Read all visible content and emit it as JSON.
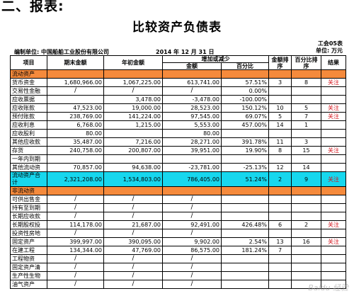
{
  "heading": "二、报表:",
  "title": "比较资产负债表",
  "form_code": "工会05表",
  "unit": "单位: 万元",
  "compiler": "编制单位: 中国船舶工业股份有限公司",
  "date": "2014 年 12 月 31 日",
  "headers": {
    "item": "项目",
    "end": "期末金额",
    "begin": "年初金额",
    "change": "增加或减少",
    "amount": "金额",
    "pct": "百分比",
    "rank_amount": "金额排序",
    "rank_pct": "百分比排序",
    "result": "结果"
  },
  "rows": [
    {
      "type": "section",
      "item": "流动资产"
    },
    {
      "item": "货币资金",
      "end": "1,680,966.00",
      "begin": "1,067,225.00",
      "amount": "613,741.00",
      "pct": "57.51%",
      "ra": "3",
      "rp": "8",
      "res": "关注"
    },
    {
      "item": "交易性金融",
      "end": "/",
      "begin": "/",
      "amount": "/",
      "pct": "0.00%",
      "ra": "",
      "rp": "",
      "res": ""
    },
    {
      "item": "应收票据",
      "end": "",
      "begin": "3,478.00",
      "amount": "-3,478.00",
      "pct": "-100.00%",
      "ra": "",
      "rp": "",
      "res": ""
    },
    {
      "item": "应收账款",
      "end": "47,523.00",
      "begin": "19,000.00",
      "amount": "28,523.00",
      "pct": "150.12%",
      "ra": "10",
      "rp": "5",
      "res": "关注"
    },
    {
      "item": "预付账款",
      "end": "238,769.00",
      "begin": "141,224.00",
      "amount": "97,545.00",
      "pct": "69.07%",
      "ra": "5",
      "rp": "7",
      "res": "关注"
    },
    {
      "item": "应收利息",
      "end": "6,768.00",
      "begin": "1,215.00",
      "amount": "5,553.00",
      "pct": "457.00%",
      "ra": "14",
      "rp": "1",
      "res": ""
    },
    {
      "item": "应收股利",
      "end": "80.00",
      "begin": "",
      "amount": "80.00",
      "pct": "",
      "ra": "",
      "rp": "",
      "res": ""
    },
    {
      "item": "其他应收款",
      "end": "35,487.00",
      "begin": "7,216.00",
      "amount": "28,271.00",
      "pct": "391.78%",
      "ra": "11",
      "rp": "3",
      "res": ""
    },
    {
      "item": "存货",
      "end": "240,758.00",
      "begin": "200,807.00",
      "amount": "39,951.00",
      "pct": "19.90%",
      "ra": "8",
      "rp": "15",
      "res": "关注"
    },
    {
      "item": "一年内到期",
      "end": "",
      "begin": "",
      "amount": "",
      "pct": "",
      "ra": "",
      "rp": "",
      "res": ""
    },
    {
      "item": "其他流动资",
      "end": "70,857.00",
      "begin": "94,638.00",
      "amount": "-23,781.00",
      "pct": "-25.13%",
      "ra": "12",
      "rp": "14",
      "res": ""
    },
    {
      "type": "total",
      "item": "流动资产合计",
      "end": "2,321,208.00",
      "begin": "1,534,803.00",
      "amount": "786,405.00",
      "pct": "51.24%",
      "ra": "2",
      "rp": "9",
      "res": "关注"
    },
    {
      "type": "section",
      "item": "非流动资"
    },
    {
      "item": "可供出售金",
      "end": "/",
      "begin": "/",
      "amount": "/",
      "pct": "",
      "ra": "",
      "rp": "",
      "res": ""
    },
    {
      "item": "持有至到期",
      "end": "/",
      "begin": "/",
      "amount": "/",
      "pct": "",
      "ra": "",
      "rp": "",
      "res": ""
    },
    {
      "item": "长期应收款",
      "end": "/",
      "begin": "/",
      "amount": "/",
      "pct": "",
      "ra": "",
      "rp": "",
      "res": ""
    },
    {
      "item": "长期股权投",
      "end": "114,178.00",
      "begin": "21,687.00",
      "amount": "92,491.00",
      "pct": "426.48%",
      "ra": "6",
      "rp": "2",
      "res": "关注"
    },
    {
      "item": "投资性房地",
      "end": "/",
      "begin": "/",
      "amount": "/",
      "pct": "",
      "ra": "",
      "rp": "",
      "res": ""
    },
    {
      "item": "固定资产",
      "end": "399,997.00",
      "begin": "390,095.00",
      "amount": "9,902.00",
      "pct": "2.54%",
      "ra": "13",
      "rp": "16",
      "res": "关注"
    },
    {
      "item": "在建工程",
      "end": "134,344.00",
      "begin": "47,769.00",
      "amount": "86,575.00",
      "pct": "181.24%",
      "ra": "7",
      "rp": "",
      "res": ""
    },
    {
      "item": "工程物资",
      "end": "/",
      "begin": "/",
      "amount": "/",
      "pct": "",
      "ra": "",
      "rp": "",
      "res": ""
    },
    {
      "item": "固定资产清",
      "end": "/",
      "begin": "/",
      "amount": "/",
      "pct": "",
      "ra": "",
      "rp": "",
      "res": ""
    },
    {
      "item": "生产性生物",
      "end": "/",
      "begin": "/",
      "amount": "/",
      "pct": "",
      "ra": "",
      "rp": "",
      "res": ""
    },
    {
      "item": "油气资产",
      "end": "/",
      "begin": "/",
      "amount": "/",
      "pct": "",
      "ra": "",
      "rp": "",
      "res": ""
    }
  ]
}
